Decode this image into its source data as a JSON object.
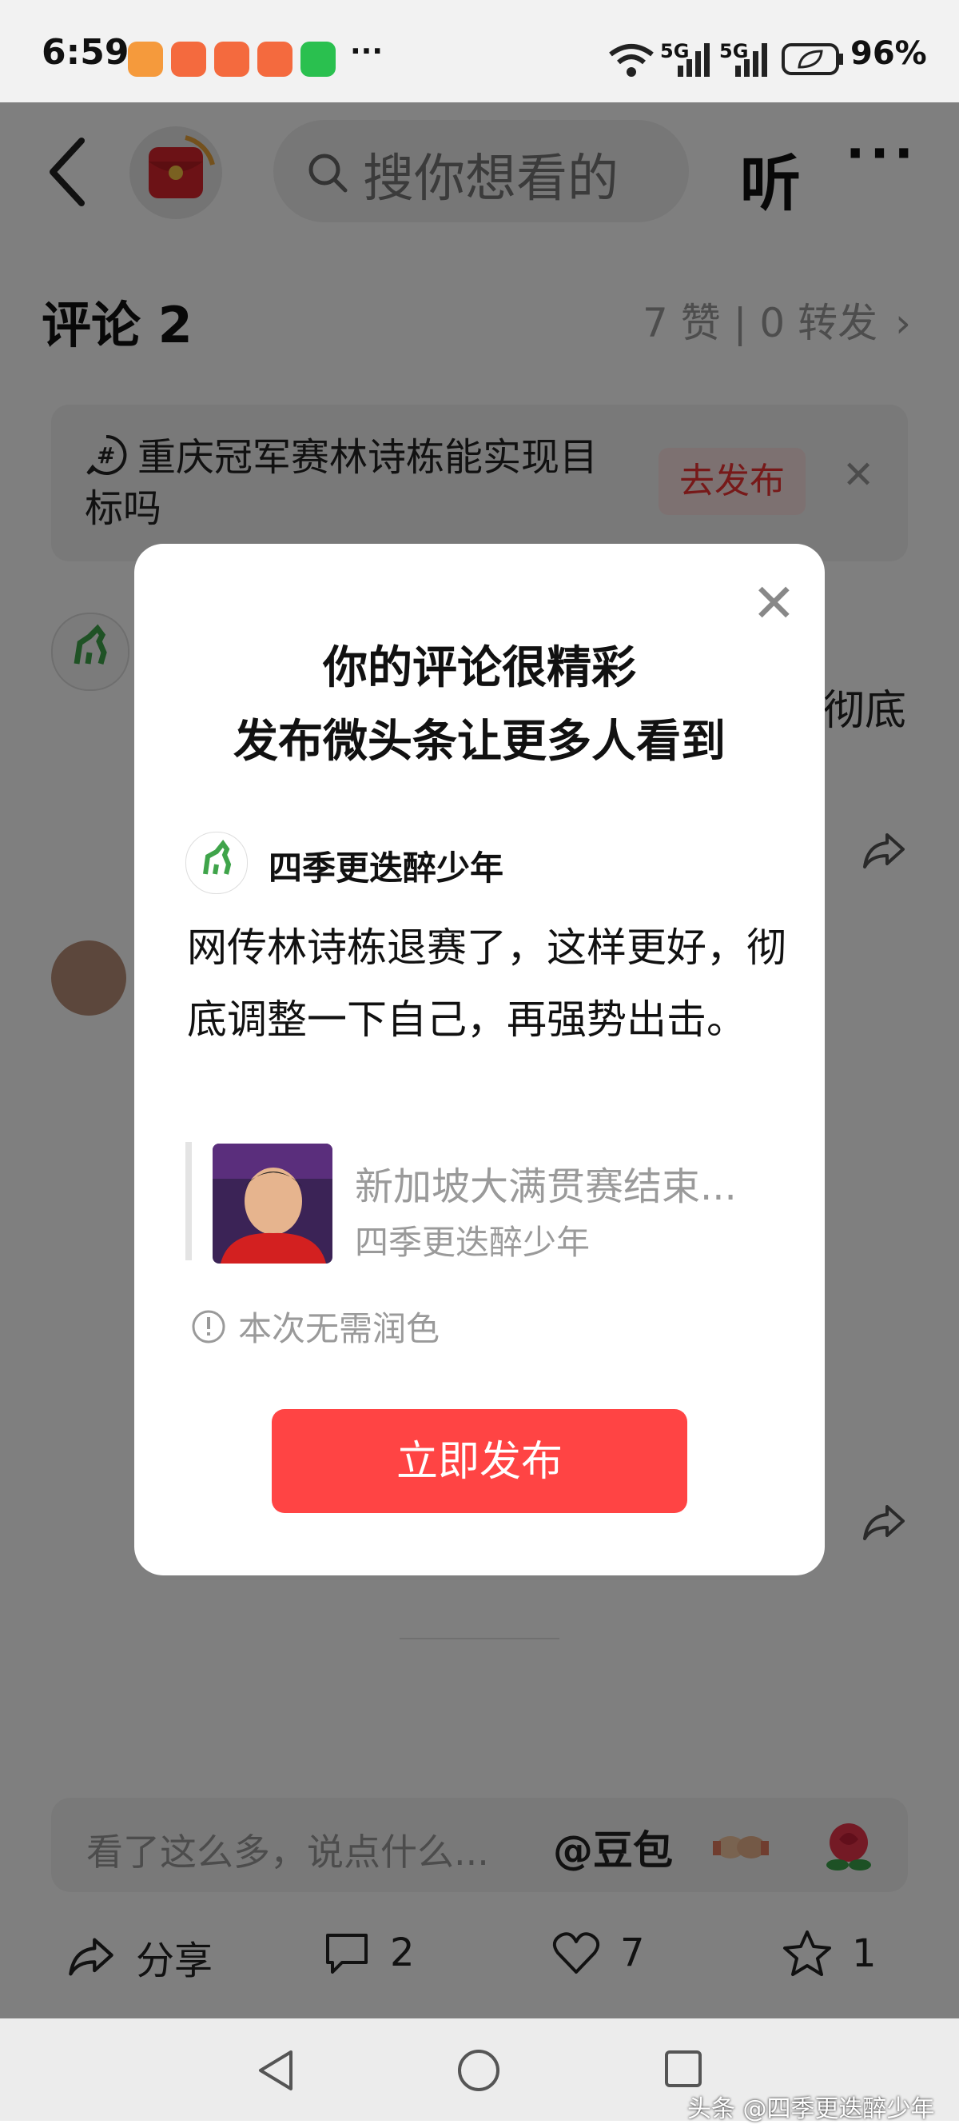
{
  "status_bar": {
    "time": "6:59",
    "battery": "96%",
    "network_labels": [
      "5G",
      "5G"
    ],
    "notification_icons": [
      "heart-app-icon",
      "video-app-icon",
      "video-app-icon",
      "video-app-icon",
      "wechat-icon"
    ],
    "more_indicator": "···"
  },
  "header": {
    "search_placeholder": "搜你想看的",
    "listen_label": "听",
    "more_label": "···"
  },
  "comments_header": {
    "title": "评论 2",
    "stats": "7 赞 | 0 转发"
  },
  "topic_banner": {
    "text": "重庆冠军赛林诗栋能实现目标吗",
    "button": "去发布",
    "close": "✕"
  },
  "background": {
    "partial_text": "彻底"
  },
  "input_bar": {
    "placeholder": "看了这么多，说点什么...",
    "mention": "@豆包"
  },
  "actions": [
    {
      "label": "分享",
      "icon": "share-icon"
    },
    {
      "label": "2",
      "icon": "comment-icon"
    },
    {
      "label": "7",
      "icon": "like-icon"
    },
    {
      "label": "1",
      "icon": "star-icon"
    }
  ],
  "modal": {
    "title_line1": "你的评论很精彩",
    "title_line2": "发布微头条让更多人看到",
    "username": "四季更迭醉少年",
    "comment": "网传林诗栋退赛了，这样更好，彻底调整一下自己，再强势出击。",
    "ref_title": "新加坡大满贯赛结束...",
    "ref_author": "四季更迭醉少年",
    "note": "本次无需润色",
    "publish_button": "立即发布",
    "close": "✕"
  },
  "watermark": "头条 @四季更迭醉少年",
  "colors": {
    "accent_red": "#ff4444",
    "overlay": "rgba(0,0,0,0.5)",
    "muted_text": "#9a9a9a"
  }
}
